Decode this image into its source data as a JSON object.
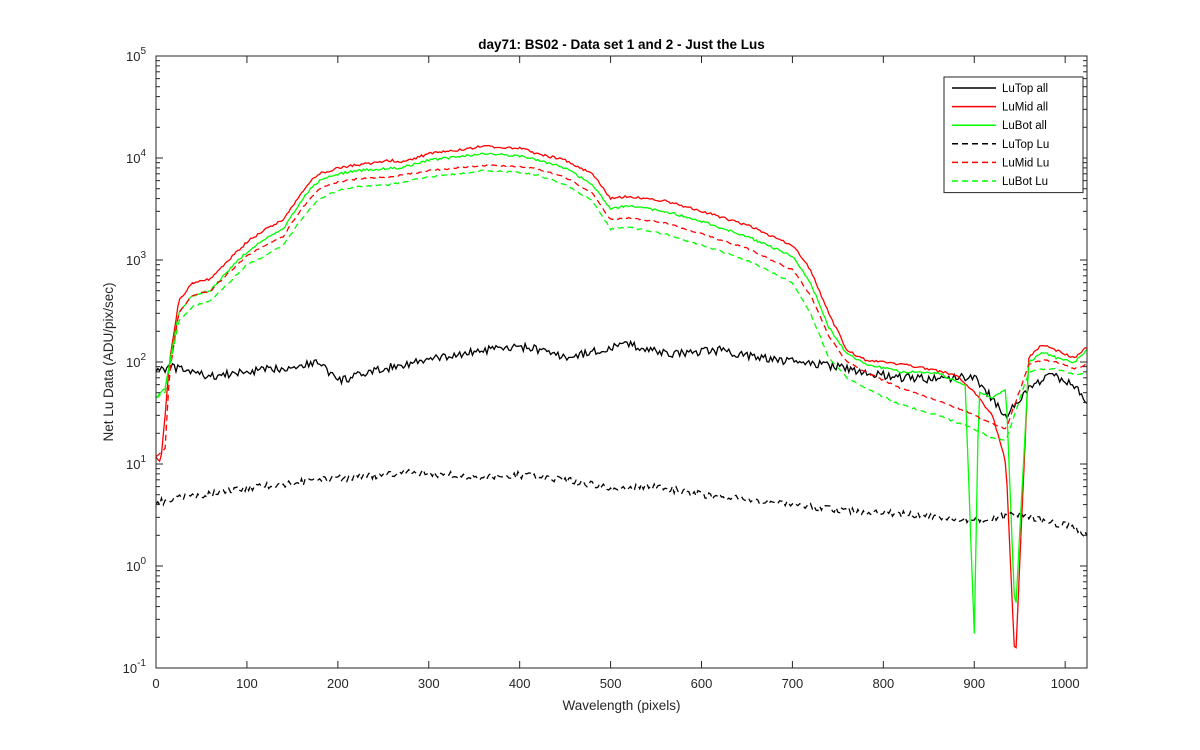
{
  "chart_data": {
    "type": "line",
    "title": "day71: BS02 - Data set 1 and 2 - Just the Lus",
    "xlabel": "Wavelength (pixels)",
    "ylabel": "Net Lu Data (ADU/pix/sec)",
    "xlim": [
      0,
      1024
    ],
    "ylim": [
      0.1,
      100000
    ],
    "yscale": "log",
    "grid": false,
    "legend_position": "top-right",
    "x_ticks": [
      "0",
      "100",
      "200",
      "300",
      "400",
      "500",
      "600",
      "700",
      "800",
      "900",
      "1000"
    ],
    "y_ticks": [
      {
        "base": "10",
        "exp": "-1"
      },
      {
        "base": "10",
        "exp": "0"
      },
      {
        "base": "10",
        "exp": "1"
      },
      {
        "base": "10",
        "exp": "2"
      },
      {
        "base": "10",
        "exp": "3"
      },
      {
        "base": "10",
        "exp": "4"
      },
      {
        "base": "10",
        "exp": "5"
      }
    ],
    "series": [
      {
        "name": "LuTop  all",
        "color": "#000000",
        "dash": "solid",
        "x": [
          0,
          20,
          60,
          100,
          150,
          180,
          200,
          260,
          300,
          360,
          410,
          450,
          520,
          560,
          620,
          680,
          730,
          780,
          820,
          860,
          900,
          935,
          960,
          985,
          1010,
          1024
        ],
        "y": [
          85,
          88,
          72,
          80,
          90,
          100,
          65,
          90,
          105,
          130,
          140,
          110,
          150,
          120,
          130,
          105,
          95,
          80,
          70,
          68,
          72,
          30,
          55,
          75,
          60,
          42
        ]
      },
      {
        "name": "LuMid  all",
        "color": "#ff0000",
        "dash": "solid",
        "x": [
          0,
          5,
          10,
          15,
          25,
          40,
          60,
          80,
          100,
          120,
          140,
          160,
          170,
          180,
          200,
          220,
          260,
          270,
          300,
          360,
          400,
          420,
          450,
          480,
          500,
          520,
          560,
          600,
          650,
          700,
          720,
          740,
          760,
          780,
          820,
          850,
          880,
          900,
          920,
          935,
          945,
          960,
          975,
          990,
          1010,
          1024
        ],
        "y": [
          12,
          10,
          30,
          100,
          400,
          600,
          650,
          1000,
          1500,
          2000,
          2500,
          4500,
          6000,
          7000,
          8000,
          8500,
          9500,
          9000,
          11000,
          13000,
          12500,
          11000,
          9500,
          7000,
          4000,
          4200,
          3800,
          3000,
          2200,
          1400,
          800,
          300,
          130,
          105,
          95,
          85,
          75,
          50,
          30,
          10,
          0.1,
          110,
          150,
          130,
          110,
          140
        ]
      },
      {
        "name": "LuBot  all",
        "color": "#00ff00",
        "dash": "solid",
        "x": [
          0,
          10,
          15,
          25,
          40,
          60,
          80,
          100,
          120,
          140,
          160,
          170,
          180,
          200,
          220,
          260,
          270,
          300,
          360,
          400,
          420,
          450,
          480,
          500,
          520,
          560,
          600,
          650,
          700,
          720,
          740,
          760,
          780,
          820,
          860,
          890,
          900,
          905,
          920,
          935,
          945,
          960,
          975,
          990,
          1010,
          1024
        ],
        "y": [
          45,
          55,
          100,
          300,
          450,
          500,
          800,
          1200,
          1600,
          2000,
          3800,
          5000,
          6000,
          7000,
          7500,
          8000,
          8000,
          9500,
          11000,
          10500,
          9500,
          8000,
          5500,
          3200,
          3400,
          3000,
          2400,
          1700,
          1100,
          600,
          220,
          120,
          95,
          80,
          78,
          60,
          0.22,
          50,
          45,
          55,
          0.3,
          100,
          125,
          110,
          100,
          130
        ]
      },
      {
        "name": "LuTop  Lu",
        "color": "#000000",
        "dash": "dashed",
        "x": [
          0,
          50,
          100,
          150,
          200,
          250,
          280,
          300,
          350,
          400,
          450,
          500,
          550,
          600,
          650,
          700,
          750,
          800,
          850,
          900,
          950,
          1000,
          1024
        ],
        "y": [
          4.2,
          5,
          5.8,
          6.5,
          7.2,
          7.8,
          8.5,
          8,
          7.5,
          7.8,
          7,
          5.8,
          6,
          5,
          4.5,
          4,
          3.6,
          3.3,
          3.1,
          2.8,
          3.2,
          2.5,
          2
        ]
      },
      {
        "name": "LuMid  Lu",
        "color": "#ff0000",
        "dash": "dashed",
        "x": [
          0,
          10,
          15,
          25,
          40,
          60,
          80,
          100,
          120,
          140,
          160,
          170,
          180,
          200,
          220,
          260,
          270,
          300,
          360,
          400,
          420,
          450,
          480,
          500,
          520,
          560,
          600,
          650,
          700,
          720,
          740,
          760,
          780,
          820,
          860,
          900,
          920,
          935,
          960,
          975,
          990,
          1010,
          1024
        ],
        "y": [
          12,
          14,
          80,
          300,
          450,
          500,
          750,
          1100,
          1400,
          1700,
          3200,
          4000,
          5000,
          5800,
          6200,
          6500,
          6800,
          7500,
          8500,
          8200,
          7800,
          6500,
          4500,
          2500,
          2600,
          2300,
          1800,
          1300,
          800,
          450,
          180,
          100,
          80,
          55,
          42,
          30,
          25,
          22,
          95,
          105,
          100,
          85,
          95
        ]
      },
      {
        "name": "LuBot  Lu",
        "color": "#00ff00",
        "dash": "dashed",
        "x": [
          0,
          10,
          15,
          25,
          40,
          60,
          80,
          100,
          120,
          140,
          160,
          170,
          180,
          200,
          220,
          260,
          270,
          300,
          360,
          400,
          420,
          450,
          480,
          500,
          520,
          560,
          600,
          650,
          700,
          720,
          740,
          760,
          780,
          820,
          860,
          900,
          920,
          935,
          960,
          975,
          990,
          1010,
          1024
        ],
        "y": [
          45,
          50,
          90,
          250,
          350,
          400,
          600,
          900,
          1100,
          1400,
          2500,
          3200,
          4000,
          4800,
          5200,
          5500,
          5800,
          6500,
          7500,
          7200,
          6800,
          5500,
          3800,
          2000,
          2100,
          1800,
          1400,
          1000,
          600,
          300,
          110,
          70,
          55,
          38,
          30,
          22,
          18,
          17,
          80,
          85,
          85,
          75,
          80
        ]
      }
    ]
  }
}
